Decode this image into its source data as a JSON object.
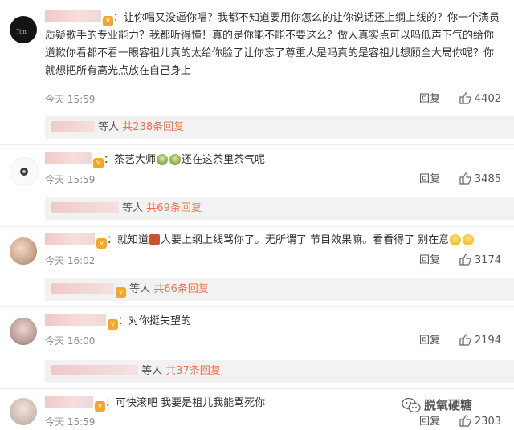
{
  "comments": [
    {
      "text": "：让你唱又没逼你唱？我都不知道要用你怎么的让你说话还上纲上线的？你一个演员质疑歌手的专业能力？我都听得懂！真的是你能不能不要这么？做人真实点可以吗低声下气的给你道歉你看都不看一眼容祖儿真的太给你脸了让你忘了尊重人是吗真的是容祖儿想顾全大局你呢？你就想把所有高光点放在自己身上",
      "time": "今天 15:59",
      "reply_label": "回复",
      "likes": "4402",
      "replies_prefix": "等人",
      "replies_count": "共238条回复"
    },
    {
      "text_a": "：茶艺大师",
      "text_b": "还在这茶里茶气呢",
      "time": "今天 15:59",
      "reply_label": "回复",
      "likes": "3485",
      "replies_prefix": "等人",
      "replies_count": "共69条回复"
    },
    {
      "text_a": "：就知道",
      "text_b": "人要上纲上线骂你了。无所谓了 节目效果嘛。看看得了 别在意",
      "time": "今天 16:02",
      "reply_label": "回复",
      "likes": "3174",
      "replies_prefix": "等人",
      "replies_count": "共66条回复"
    },
    {
      "text": "：对你挺失望的",
      "time": "今天 16:00",
      "reply_label": "回复",
      "likes": "2194",
      "replies_prefix": "等人",
      "replies_count": "共37条回复"
    },
    {
      "text": "：可快滚吧 我要是祖儿我能骂死你",
      "time": "今天 15:59",
      "reply_label": "回复",
      "likes": "2303"
    }
  ],
  "watermark": "脱氧硬糖",
  "colors": {
    "link": "#eb7350",
    "meta": "#8c8c8c",
    "reply_bg": "#f2f2f2"
  }
}
